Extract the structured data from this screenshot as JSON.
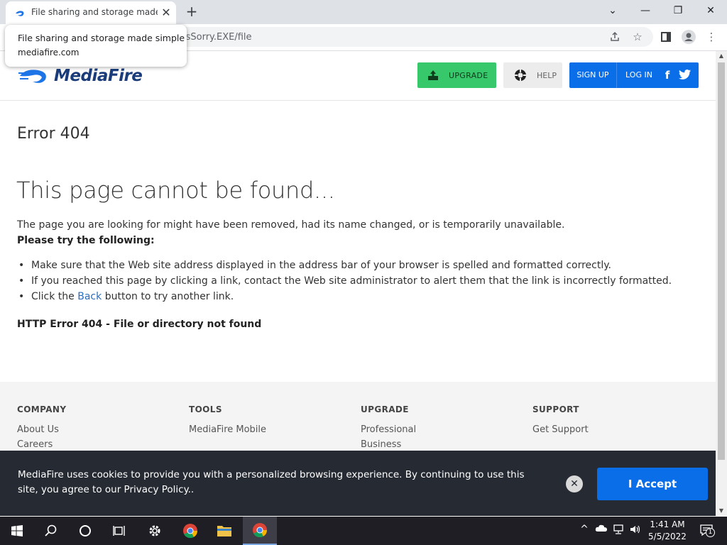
{
  "browser": {
    "tab_title": "File sharing and storage made simple",
    "url_visible": "lsSorry.EXE/file",
    "tooltip": {
      "title": "File sharing and storage made simple",
      "domain": "mediafire.com"
    }
  },
  "header": {
    "logo_text": "MediaFire",
    "upgrade_label": "UPGRADE",
    "help_label": "HELP",
    "signup_label": "SIGN UP",
    "login_label": "LOG IN"
  },
  "error": {
    "code": "Error 404",
    "title": "This page cannot be found...",
    "description": "The page you are looking for might have been removed, had its name changed, or is temporarily unavailable.",
    "try_heading": "Please try the following:",
    "items": [
      "Make sure that the Web site address displayed in the address bar of your browser is spelled and formatted correctly.",
      "If you reached this page by clicking a link, contact the Web site administrator to alert them that the link is incorrectly formatted."
    ],
    "item3_prefix": "Click the",
    "item3_link": "Back",
    "item3_suffix": "button to try another link.",
    "http_error": "HTTP Error 404 - File or directory not found"
  },
  "footer": {
    "company": {
      "heading": "COMPANY",
      "links": [
        "About Us",
        "Careers"
      ]
    },
    "tools": {
      "heading": "TOOLS",
      "links": [
        "MediaFire Mobile"
      ]
    },
    "upgrade": {
      "heading": "UPGRADE",
      "links": [
        "Professional",
        "Business"
      ]
    },
    "support": {
      "heading": "SUPPORT",
      "links": [
        "Get Support"
      ]
    }
  },
  "cookie": {
    "text": "MediaFire uses cookies to provide you with a personalized browsing experience. By continuing to use this site, you agree to our Privacy Policy..",
    "accept_label": "I Accept"
  },
  "taskbar": {
    "time": "1:41 AM",
    "date": "5/5/2022",
    "notification_count": "1"
  },
  "colors": {
    "brand_blue": "#0a6ee8",
    "upgrade_green": "#36c86a",
    "cookie_bg": "#262a33",
    "logo_navy": "#1a3c7a"
  },
  "icons": [
    "mediafire-favicon",
    "close-icon",
    "plus-icon",
    "chevron-down-icon",
    "minimize-icon",
    "restore-icon",
    "share-icon",
    "star-icon",
    "sidepanel-icon",
    "profile-icon",
    "menu-icon",
    "upgrade-icon",
    "help-icon",
    "facebook-icon",
    "twitter-icon",
    "windows-icon",
    "search-icon",
    "cortana-icon",
    "taskview-icon",
    "settings-icon",
    "chrome-icon",
    "folder-icon",
    "cloud-icon",
    "network-icon",
    "volume-icon",
    "notification-icon"
  ]
}
